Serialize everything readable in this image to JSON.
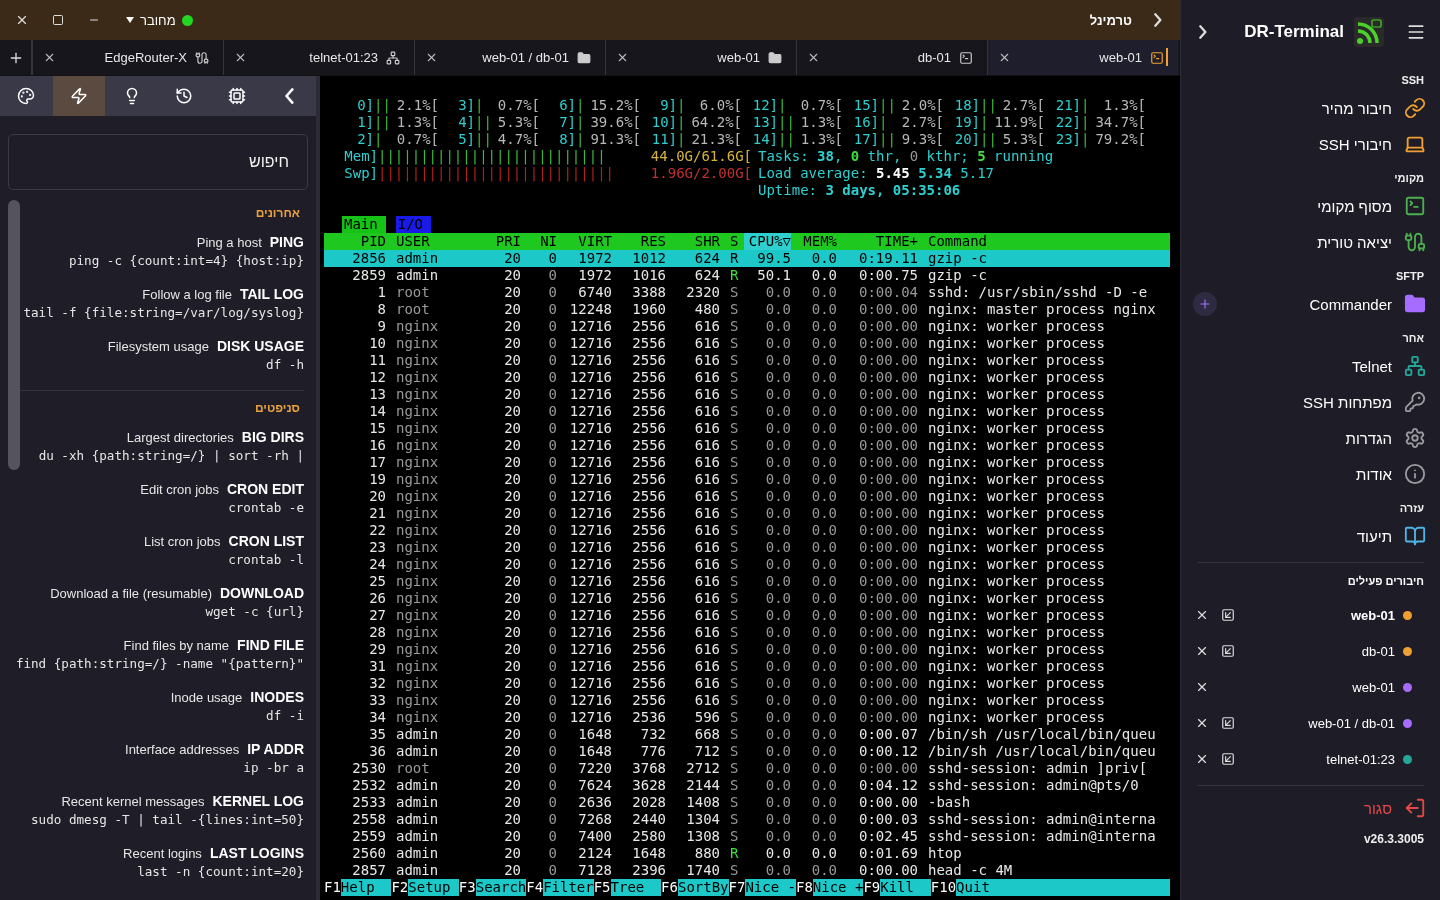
{
  "window": {
    "title": "טרמינל",
    "status": "מחובר",
    "connected": true
  },
  "tabs": [
    {
      "label": "EdgeRouter-X",
      "kind": "cable",
      "selected": false
    },
    {
      "label": "telnet-01:23",
      "kind": "network",
      "selected": false
    },
    {
      "label": "web-01 / db-01",
      "kind": "folder",
      "selected": false
    },
    {
      "label": "web-01",
      "kind": "folder",
      "selected": false
    },
    {
      "label": "db-01",
      "kind": "terminal",
      "selected": false
    },
    {
      "label": "web-01",
      "kind": "terminal",
      "selected": true
    }
  ],
  "tools": [
    {
      "kind": "palette",
      "selected": false
    },
    {
      "kind": "zap",
      "selected": true
    },
    {
      "kind": "bulb",
      "selected": false
    },
    {
      "kind": "history",
      "selected": false
    },
    {
      "kind": "cpu",
      "selected": false
    },
    {
      "kind": "collapse",
      "selected": false
    }
  ],
  "search": {
    "placeholder": "חיפוש"
  },
  "snippet_sections": [
    {
      "title": "אחרונים",
      "items": [
        {
          "description": "Ping a host",
          "name": "PING",
          "command": "ping -c {count:int=4} {host:ip}"
        },
        {
          "description": "Follow a log file",
          "name": "TAIL LOG",
          "command": "tail -f {file:string=/var/log/syslog}"
        },
        {
          "description": "Filesystem usage",
          "name": "DISK USAGE",
          "command": "df -h"
        }
      ]
    },
    {
      "title": "סניפטים",
      "items": [
        {
          "description": "Largest directories",
          "name": "BIG DIRS",
          "command": "du -xh {path:string=/} | sort -rh |"
        },
        {
          "description": "Edit cron jobs",
          "name": "CRON EDIT",
          "command": "crontab -e"
        },
        {
          "description": "List cron jobs",
          "name": "CRON LIST",
          "command": "crontab -l"
        },
        {
          "description": "Download a file (resumable)",
          "name": "DOWNLOAD",
          "command": "wget -c {url}"
        },
        {
          "description": "Find files by name",
          "name": "FIND FILE",
          "command": "find {path:string=/} -name \"{pattern}\""
        },
        {
          "description": "Inode usage",
          "name": "INODES",
          "command": "df -i"
        },
        {
          "description": "Interface addresses",
          "name": "IP ADDR",
          "command": "ip -br a"
        },
        {
          "description": "Recent kernel messages",
          "name": "KERNEL LOG",
          "command": "sudo dmesg -T | tail -{lines:int=50}"
        },
        {
          "description": "Recent logins",
          "name": "LAST LOGINS",
          "command": "last -n {count:int=20}"
        }
      ]
    }
  ],
  "terminal": {
    "cpu_meters": [
      {
        "label": "0]",
        "bar": "||",
        "reading": "2.1%["
      },
      {
        "label": "3]",
        "bar": "|",
        "reading": "0.7%["
      },
      {
        "label": "6]",
        "bar": "|",
        "reading": "15.2%["
      },
      {
        "label": "9]",
        "bar": "|",
        "reading": "6.0%["
      },
      {
        "label": "12]",
        "bar": "|",
        "reading": "0.7%["
      },
      {
        "label": "15]",
        "bar": "||",
        "reading": "2.0%["
      },
      {
        "label": "18]",
        "bar": "||",
        "reading": "2.7%["
      },
      {
        "label": "21]",
        "bar": "|",
        "reading": "1.3%["
      },
      {
        "label": "1]",
        "bar": "||",
        "reading": "1.3%["
      },
      {
        "label": "4]",
        "bar": "||",
        "reading": "5.3%["
      },
      {
        "label": "7]",
        "bar": "|",
        "reading": "39.6%["
      },
      {
        "label": "10]",
        "bar": "|",
        "reading": "64.2%["
      },
      {
        "label": "13]",
        "bar": "||",
        "reading": "1.3%["
      },
      {
        "label": "16]",
        "bar": "|",
        "reading": "2.7%["
      },
      {
        "label": "19]",
        "bar": "|",
        "reading": "11.9%["
      },
      {
        "label": "22]",
        "bar": "|",
        "reading": "34.7%["
      },
      {
        "label": "2]",
        "bar": "|",
        "reading": "0.7%["
      },
      {
        "label": "5]",
        "bar": "||",
        "reading": "4.7%["
      },
      {
        "label": "8]",
        "bar": "|",
        "reading": "91.3%["
      },
      {
        "label": "11]",
        "bar": "|",
        "reading": "21.3%["
      },
      {
        "label": "14]",
        "bar": "||",
        "reading": "1.3%["
      },
      {
        "label": "17]",
        "bar": "||",
        "reading": "9.3%["
      },
      {
        "label": "20]",
        "bar": "||",
        "reading": "5.3%["
      },
      {
        "label": "23]",
        "bar": "|",
        "reading": "79.2%["
      }
    ],
    "memory_meters": [
      {
        "label": "Mem]",
        "bar": "|||||||||||||||||||||||||||",
        "reading": "44.0G/61.6G[",
        "kind": "mem"
      },
      {
        "label": "Swp]",
        "bar": "||||||||||||||||||||||||||||",
        "reading": "1.96G/2.00G[",
        "kind": "swap"
      }
    ],
    "info_lines": [
      [
        {
          "text": "Tasks: ",
          "kind": "label"
        },
        {
          "text": "38",
          "kind": "strong"
        },
        {
          "text": ", ",
          "kind": "label"
        },
        {
          "text": "0",
          "kind": "accent"
        },
        {
          "text": " thr, ",
          "kind": "label"
        },
        {
          "text": "0",
          "kind": "dim"
        },
        {
          "text": " kthr; ",
          "kind": "label"
        },
        {
          "text": "5",
          "kind": "accent"
        },
        {
          "text": " running",
          "kind": "label"
        }
      ],
      [
        {
          "text": "Load average: ",
          "kind": "label"
        },
        {
          "text": "5.45 ",
          "kind": "bold"
        },
        {
          "text": "5.34 ",
          "kind": "strong"
        },
        {
          "text": "5.17",
          "kind": "label"
        }
      ],
      [
        {
          "text": "Uptime: ",
          "kind": "label"
        },
        {
          "text": "3 days, 05:35:06",
          "kind": "strong"
        }
      ]
    ],
    "screen_tabs": [
      {
        "label": "Main",
        "selected": true
      },
      {
        "label": "I/O",
        "selected": false
      }
    ],
    "columns": [
      {
        "label": "PID",
        "sorted": false
      },
      {
        "label": "USER",
        "sorted": false
      },
      {
        "label": "PRI",
        "sorted": false
      },
      {
        "label": "NI",
        "sorted": false
      },
      {
        "label": "VIRT",
        "sorted": false
      },
      {
        "label": "RES",
        "sorted": false
      },
      {
        "label": "SHR",
        "sorted": false
      },
      {
        "label": "S",
        "sorted": false
      },
      {
        "label": "CPU%▽",
        "sorted": true
      },
      {
        "label": "MEM%",
        "sorted": false
      },
      {
        "label": "TIME+",
        "sorted": false
      },
      {
        "label": "Command",
        "sorted": false
      }
    ],
    "processes": [
      {
        "pid": "2856",
        "user": "admin",
        "pri": "20",
        "ni": "0",
        "virt": "1972",
        "res": "1012",
        "shr": "624",
        "s": "R",
        "cpu": "99.5",
        "mem": "0.0",
        "time": "0:19.11",
        "command": "gzip -c",
        "selected": true,
        "running": true,
        "other_user": false
      },
      {
        "pid": "2859",
        "user": "admin",
        "pri": "20",
        "ni": "0",
        "virt": "1972",
        "res": "1016",
        "shr": "624",
        "s": "R",
        "cpu": "50.1",
        "mem": "0.0",
        "time": "0:00.75",
        "command": "gzip -c",
        "selected": false,
        "running": true,
        "other_user": false
      },
      {
        "pid": "1",
        "user": "root",
        "pri": "20",
        "ni": "0",
        "virt": "6740",
        "res": "3388",
        "shr": "2320",
        "s": "S",
        "cpu": "0.0",
        "mem": "0.0",
        "time": "0:00.04",
        "command": "sshd: /usr/sbin/sshd -D -e",
        "selected": false,
        "running": false,
        "other_user": true
      },
      {
        "pid": "8",
        "user": "root",
        "pri": "20",
        "ni": "0",
        "virt": "12248",
        "res": "1960",
        "shr": "480",
        "s": "S",
        "cpu": "0.0",
        "mem": "0.0",
        "time": "0:00.00",
        "command": "nginx: master process nginx",
        "selected": false,
        "running": false,
        "other_user": true
      },
      {
        "pid": "9",
        "user": "nginx",
        "pri": "20",
        "ni": "0",
        "virt": "12716",
        "res": "2556",
        "shr": "616",
        "s": "S",
        "cpu": "0.0",
        "mem": "0.0",
        "time": "0:00.00",
        "command": "nginx: worker process",
        "selected": false,
        "running": false,
        "other_user": true
      },
      {
        "pid": "10",
        "user": "nginx",
        "pri": "20",
        "ni": "0",
        "virt": "12716",
        "res": "2556",
        "shr": "616",
        "s": "S",
        "cpu": "0.0",
        "mem": "0.0",
        "time": "0:00.00",
        "command": "nginx: worker process",
        "selected": false,
        "running": false,
        "other_user": true
      },
      {
        "pid": "11",
        "user": "nginx",
        "pri": "20",
        "ni": "0",
        "virt": "12716",
        "res": "2556",
        "shr": "616",
        "s": "S",
        "cpu": "0.0",
        "mem": "0.0",
        "time": "0:00.00",
        "command": "nginx: worker process",
        "selected": false,
        "running": false,
        "other_user": true
      },
      {
        "pid": "12",
        "user": "nginx",
        "pri": "20",
        "ni": "0",
        "virt": "12716",
        "res": "2556",
        "shr": "616",
        "s": "S",
        "cpu": "0.0",
        "mem": "0.0",
        "time": "0:00.00",
        "command": "nginx: worker process",
        "selected": false,
        "running": false,
        "other_user": true
      },
      {
        "pid": "13",
        "user": "nginx",
        "pri": "20",
        "ni": "0",
        "virt": "12716",
        "res": "2556",
        "shr": "616",
        "s": "S",
        "cpu": "0.0",
        "mem": "0.0",
        "time": "0:00.00",
        "command": "nginx: worker process",
        "selected": false,
        "running": false,
        "other_user": true
      },
      {
        "pid": "14",
        "user": "nginx",
        "pri": "20",
        "ni": "0",
        "virt": "12716",
        "res": "2556",
        "shr": "616",
        "s": "S",
        "cpu": "0.0",
        "mem": "0.0",
        "time": "0:00.00",
        "command": "nginx: worker process",
        "selected": false,
        "running": false,
        "other_user": true
      },
      {
        "pid": "15",
        "user": "nginx",
        "pri": "20",
        "ni": "0",
        "virt": "12716",
        "res": "2556",
        "shr": "616",
        "s": "S",
        "cpu": "0.0",
        "mem": "0.0",
        "time": "0:00.00",
        "command": "nginx: worker process",
        "selected": false,
        "running": false,
        "other_user": true
      },
      {
        "pid": "16",
        "user": "nginx",
        "pri": "20",
        "ni": "0",
        "virt": "12716",
        "res": "2556",
        "shr": "616",
        "s": "S",
        "cpu": "0.0",
        "mem": "0.0",
        "time": "0:00.00",
        "command": "nginx: worker process",
        "selected": false,
        "running": false,
        "other_user": true
      },
      {
        "pid": "17",
        "user": "nginx",
        "pri": "20",
        "ni": "0",
        "virt": "12716",
        "res": "2556",
        "shr": "616",
        "s": "S",
        "cpu": "0.0",
        "mem": "0.0",
        "time": "0:00.00",
        "command": "nginx: worker process",
        "selected": false,
        "running": false,
        "other_user": true
      },
      {
        "pid": "19",
        "user": "nginx",
        "pri": "20",
        "ni": "0",
        "virt": "12716",
        "res": "2556",
        "shr": "616",
        "s": "S",
        "cpu": "0.0",
        "mem": "0.0",
        "time": "0:00.00",
        "command": "nginx: worker process",
        "selected": false,
        "running": false,
        "other_user": true
      },
      {
        "pid": "20",
        "user": "nginx",
        "pri": "20",
        "ni": "0",
        "virt": "12716",
        "res": "2556",
        "shr": "616",
        "s": "S",
        "cpu": "0.0",
        "mem": "0.0",
        "time": "0:00.00",
        "command": "nginx: worker process",
        "selected": false,
        "running": false,
        "other_user": true
      },
      {
        "pid": "21",
        "user": "nginx",
        "pri": "20",
        "ni": "0",
        "virt": "12716",
        "res": "2556",
        "shr": "616",
        "s": "S",
        "cpu": "0.0",
        "mem": "0.0",
        "time": "0:00.00",
        "command": "nginx: worker process",
        "selected": false,
        "running": false,
        "other_user": true
      },
      {
        "pid": "22",
        "user": "nginx",
        "pri": "20",
        "ni": "0",
        "virt": "12716",
        "res": "2556",
        "shr": "616",
        "s": "S",
        "cpu": "0.0",
        "mem": "0.0",
        "time": "0:00.00",
        "command": "nginx: worker process",
        "selected": false,
        "running": false,
        "other_user": true
      },
      {
        "pid": "23",
        "user": "nginx",
        "pri": "20",
        "ni": "0",
        "virt": "12716",
        "res": "2556",
        "shr": "616",
        "s": "S",
        "cpu": "0.0",
        "mem": "0.0",
        "time": "0:00.00",
        "command": "nginx: worker process",
        "selected": false,
        "running": false,
        "other_user": true
      },
      {
        "pid": "24",
        "user": "nginx",
        "pri": "20",
        "ni": "0",
        "virt": "12716",
        "res": "2556",
        "shr": "616",
        "s": "S",
        "cpu": "0.0",
        "mem": "0.0",
        "time": "0:00.00",
        "command": "nginx: worker process",
        "selected": false,
        "running": false,
        "other_user": true
      },
      {
        "pid": "25",
        "user": "nginx",
        "pri": "20",
        "ni": "0",
        "virt": "12716",
        "res": "2556",
        "shr": "616",
        "s": "S",
        "cpu": "0.0",
        "mem": "0.0",
        "time": "0:00.00",
        "command": "nginx: worker process",
        "selected": false,
        "running": false,
        "other_user": true
      },
      {
        "pid": "26",
        "user": "nginx",
        "pri": "20",
        "ni": "0",
        "virt": "12716",
        "res": "2556",
        "shr": "616",
        "s": "S",
        "cpu": "0.0",
        "mem": "0.0",
        "time": "0:00.00",
        "command": "nginx: worker process",
        "selected": false,
        "running": false,
        "other_user": true
      },
      {
        "pid": "27",
        "user": "nginx",
        "pri": "20",
        "ni": "0",
        "virt": "12716",
        "res": "2556",
        "shr": "616",
        "s": "S",
        "cpu": "0.0",
        "mem": "0.0",
        "time": "0:00.00",
        "command": "nginx: worker process",
        "selected": false,
        "running": false,
        "other_user": true
      },
      {
        "pid": "28",
        "user": "nginx",
        "pri": "20",
        "ni": "0",
        "virt": "12716",
        "res": "2556",
        "shr": "616",
        "s": "S",
        "cpu": "0.0",
        "mem": "0.0",
        "time": "0:00.00",
        "command": "nginx: worker process",
        "selected": false,
        "running": false,
        "other_user": true
      },
      {
        "pid": "29",
        "user": "nginx",
        "pri": "20",
        "ni": "0",
        "virt": "12716",
        "res": "2556",
        "shr": "616",
        "s": "S",
        "cpu": "0.0",
        "mem": "0.0",
        "time": "0:00.00",
        "command": "nginx: worker process",
        "selected": false,
        "running": false,
        "other_user": true
      },
      {
        "pid": "31",
        "user": "nginx",
        "pri": "20",
        "ni": "0",
        "virt": "12716",
        "res": "2556",
        "shr": "616",
        "s": "S",
        "cpu": "0.0",
        "mem": "0.0",
        "time": "0:00.00",
        "command": "nginx: worker process",
        "selected": false,
        "running": false,
        "other_user": true
      },
      {
        "pid": "32",
        "user": "nginx",
        "pri": "20",
        "ni": "0",
        "virt": "12716",
        "res": "2556",
        "shr": "616",
        "s": "S",
        "cpu": "0.0",
        "mem": "0.0",
        "time": "0:00.00",
        "command": "nginx: worker process",
        "selected": false,
        "running": false,
        "other_user": true
      },
      {
        "pid": "33",
        "user": "nginx",
        "pri": "20",
        "ni": "0",
        "virt": "12716",
        "res": "2556",
        "shr": "616",
        "s": "S",
        "cpu": "0.0",
        "mem": "0.0",
        "time": "0:00.00",
        "command": "nginx: worker process",
        "selected": false,
        "running": false,
        "other_user": true
      },
      {
        "pid": "34",
        "user": "nginx",
        "pri": "20",
        "ni": "0",
        "virt": "12716",
        "res": "2536",
        "shr": "596",
        "s": "S",
        "cpu": "0.0",
        "mem": "0.0",
        "time": "0:00.00",
        "command": "nginx: worker process",
        "selected": false,
        "running": false,
        "other_user": true
      },
      {
        "pid": "35",
        "user": "admin",
        "pri": "20",
        "ni": "0",
        "virt": "1648",
        "res": "732",
        "shr": "668",
        "s": "S",
        "cpu": "0.0",
        "mem": "0.0",
        "time": "0:00.07",
        "command": "/bin/sh /usr/local/bin/queu",
        "selected": false,
        "running": false,
        "other_user": false
      },
      {
        "pid": "36",
        "user": "admin",
        "pri": "20",
        "ni": "0",
        "virt": "1648",
        "res": "776",
        "shr": "712",
        "s": "S",
        "cpu": "0.0",
        "mem": "0.0",
        "time": "0:00.12",
        "command": "/bin/sh /usr/local/bin/queu",
        "selected": false,
        "running": false,
        "other_user": false
      },
      {
        "pid": "2530",
        "user": "root",
        "pri": "20",
        "ni": "0",
        "virt": "7220",
        "res": "3768",
        "shr": "2712",
        "s": "S",
        "cpu": "0.0",
        "mem": "0.0",
        "time": "0:00.00",
        "command": "sshd-session: admin ]priv[",
        "selected": false,
        "running": false,
        "other_user": true
      },
      {
        "pid": "2532",
        "user": "admin",
        "pri": "20",
        "ni": "0",
        "virt": "7624",
        "res": "3628",
        "shr": "2144",
        "s": "S",
        "cpu": "0.0",
        "mem": "0.0",
        "time": "0:04.12",
        "command": "sshd-session: admin@pts/0",
        "selected": false,
        "running": false,
        "other_user": false
      },
      {
        "pid": "2533",
        "user": "admin",
        "pri": "20",
        "ni": "0",
        "virt": "2636",
        "res": "2028",
        "shr": "1408",
        "s": "S",
        "cpu": "0.0",
        "mem": "0.0",
        "time": "0:00.00",
        "command": "-bash",
        "selected": false,
        "running": false,
        "other_user": false
      },
      {
        "pid": "2558",
        "user": "admin",
        "pri": "20",
        "ni": "0",
        "virt": "7268",
        "res": "2440",
        "shr": "1304",
        "s": "S",
        "cpu": "0.0",
        "mem": "0.0",
        "time": "0:00.03",
        "command": "sshd-session: admin@interna",
        "selected": false,
        "running": false,
        "other_user": false
      },
      {
        "pid": "2559",
        "user": "admin",
        "pri": "20",
        "ni": "0",
        "virt": "7400",
        "res": "2580",
        "shr": "1308",
        "s": "S",
        "cpu": "0.0",
        "mem": "0.0",
        "time": "0:02.45",
        "command": "sshd-session: admin@interna",
        "selected": false,
        "running": false,
        "other_user": false
      },
      {
        "pid": "2560",
        "user": "admin",
        "pri": "20",
        "ni": "0",
        "virt": "2124",
        "res": "1648",
        "shr": "880",
        "s": "R",
        "cpu": "0.0",
        "mem": "0.0",
        "time": "0:01.69",
        "command": "htop",
        "selected": false,
        "running": true,
        "other_user": false
      },
      {
        "pid": "2857",
        "user": "admin",
        "pri": "20",
        "ni": "0",
        "virt": "7128",
        "res": "2396",
        "shr": "1740",
        "s": "S",
        "cpu": "0.0",
        "mem": "0.0",
        "time": "0:00.00",
        "command": "head -c 4M",
        "selected": false,
        "running": false,
        "other_user": false
      }
    ],
    "function_keys": [
      {
        "key": "F1",
        "label": "Help"
      },
      {
        "key": "F2",
        "label": "Setup"
      },
      {
        "key": "F3",
        "label": "Search"
      },
      {
        "key": "F4",
        "label": "Filter"
      },
      {
        "key": "F5",
        "label": "Tree"
      },
      {
        "key": "F6",
        "label": "SortBy"
      },
      {
        "key": "F7",
        "label": "Nice -"
      },
      {
        "key": "F8",
        "label": "Nice +"
      },
      {
        "key": "F9",
        "label": "Kill"
      },
      {
        "key": "F10",
        "label": "Quit"
      }
    ]
  },
  "sidebar": {
    "title": "DR-Terminal",
    "sections": [
      {
        "title": "SSH",
        "items": [
          {
            "label": "חיבור מהיר",
            "kind": "link",
            "color": "#f0a030",
            "addable": false
          },
          {
            "label": "חיבורי SSH",
            "kind": "laptop",
            "color": "#f0a030",
            "addable": false
          }
        ]
      },
      {
        "title": "מקומי",
        "items": [
          {
            "label": "מסוף מקומי",
            "kind": "terminal",
            "color": "#4caf50",
            "addable": false
          },
          {
            "label": "יציאה טורית",
            "kind": "cable",
            "color": "#4caf50",
            "addable": false
          }
        ]
      },
      {
        "title": "SFTP",
        "items": [
          {
            "label": "Commander",
            "kind": "folder",
            "color": "#a66cff",
            "addable": true
          }
        ]
      },
      {
        "title": "אחר",
        "items": [
          {
            "label": "Telnet",
            "kind": "network",
            "color": "#26a69a",
            "addable": false
          },
          {
            "label": "מפתחות SSH",
            "kind": "key",
            "color": "#9a9aa0",
            "addable": false
          },
          {
            "label": "הגדרות",
            "kind": "gear",
            "color": "#9a9aa0",
            "addable": false
          },
          {
            "label": "אודות",
            "kind": "info",
            "color": "#9a9aa0",
            "addable": false
          }
        ]
      },
      {
        "title": "עזרה",
        "items": [
          {
            "label": "תיעוד",
            "kind": "book",
            "color": "#4fb3e8",
            "addable": false
          }
        ]
      }
    ],
    "active_title": "חיבורים פעילים",
    "connections": [
      {
        "label": "web-01",
        "color": "#f0a030",
        "selected": true,
        "detachable": true
      },
      {
        "label": "db-01",
        "color": "#f0a030",
        "selected": false,
        "detachable": true
      },
      {
        "label": "web-01",
        "color": "#a66cff",
        "selected": false,
        "detachable": false
      },
      {
        "label": "web-01 / db-01",
        "color": "#a66cff",
        "selected": false,
        "detachable": true
      },
      {
        "label": "telnet-01:23",
        "color": "#26a69a",
        "selected": false,
        "detachable": true
      }
    ],
    "close_label": "סגור",
    "version": "v26.3.3005"
  }
}
